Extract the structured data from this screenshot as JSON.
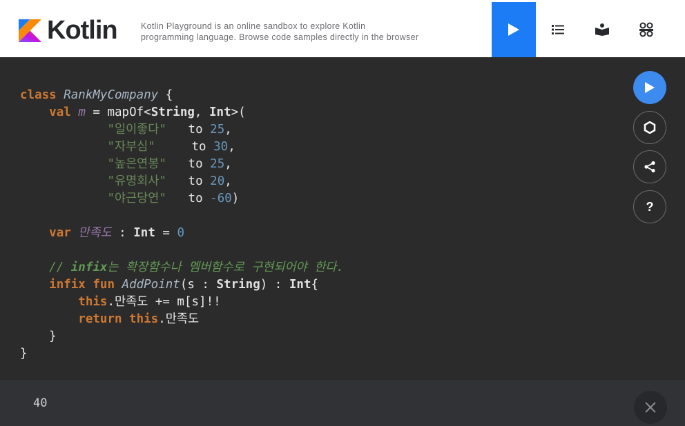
{
  "header": {
    "logo_text": "Kotlin",
    "tagline_line1": "Kotlin Playground is an online sandbox to explore Kotlin",
    "tagline_line2": "programming language. Browse code samples directly in the browser",
    "colors": {
      "run_button": "#1b7cf5",
      "background": "#ffffff"
    },
    "icons": [
      "play-icon",
      "list-icon",
      "book-icon",
      "community-icon"
    ]
  },
  "editor": {
    "code_lines": [
      "class RankMyCompany {",
      "    val m = mapOf<String, Int>(",
      "            \"일이좋다\"   to 25,",
      "            \"자부심\"     to 30,",
      "            \"높은연봉\"   to 25,",
      "            \"유명회사\"   to 20,",
      "            \"야근당연\"   to -60)",
      "",
      "    var 만족도 : Int = 0",
      "",
      "    // infix는 확장함수나 멤버함수로 구현되어야 한다.",
      "    infix fun AddPoint(s : String) : Int{",
      "        this.만족도 += m[s]!!",
      "        return this.만족도",
      "    }",
      "}"
    ],
    "side_buttons": [
      "play-icon",
      "target-icon",
      "share-icon",
      "help-icon"
    ],
    "help_label": "?",
    "colors": {
      "background": "#2b2b2b",
      "run_button": "#3e8bf0"
    }
  },
  "output": {
    "text": "40",
    "close_icon": "close-icon"
  }
}
